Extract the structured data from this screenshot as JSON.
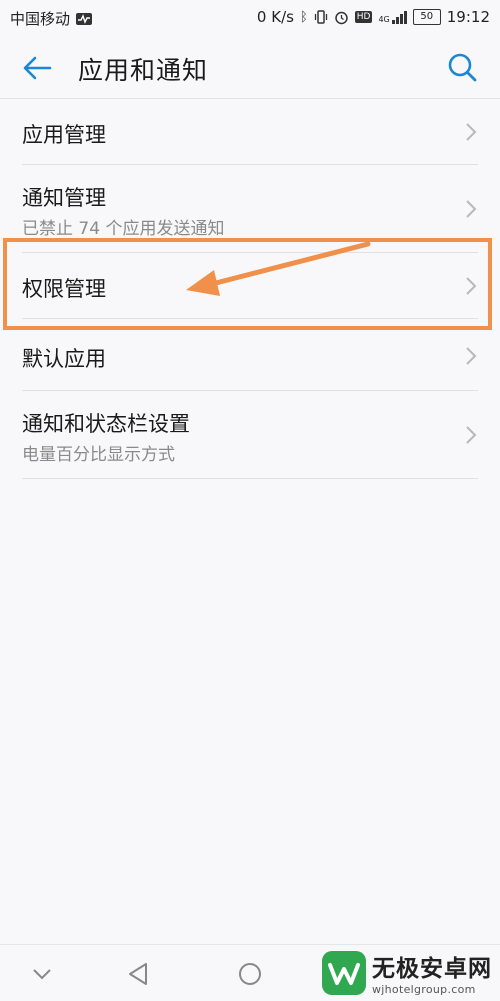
{
  "status_bar": {
    "carrier": "中国移动",
    "speed": "0 K/s",
    "network": "4G",
    "battery": "50",
    "time": "19:12",
    "icons": [
      "activity-icon",
      "bluetooth-icon",
      "vibrate-icon",
      "alarm-icon",
      "hd-icon",
      "signal-icon",
      "battery-icon"
    ]
  },
  "header": {
    "title": "应用和通知",
    "back_icon": "back-arrow-icon",
    "search_icon": "search-icon"
  },
  "items": [
    {
      "title": "应用管理",
      "subtitle": ""
    },
    {
      "title": "通知管理",
      "subtitle": "已禁止 74 个应用发送通知"
    },
    {
      "title": "权限管理",
      "subtitle": ""
    },
    {
      "title": "默认应用",
      "subtitle": ""
    },
    {
      "title": "通知和状态栏设置",
      "subtitle": "电量百分比显示方式"
    }
  ],
  "annotation": {
    "highlight_color": "#f0904a",
    "target": "权限管理"
  },
  "navbar": {
    "icons": [
      "hide-keyboard-chevron-icon",
      "back-triangle-icon",
      "home-circle-icon"
    ]
  },
  "watermark": {
    "name": "无极安卓网",
    "url": "wjhotelgroup.com"
  },
  "colors": {
    "accent": "#1a86d8",
    "background": "#f8f8fa",
    "highlight": "#f0904a"
  }
}
